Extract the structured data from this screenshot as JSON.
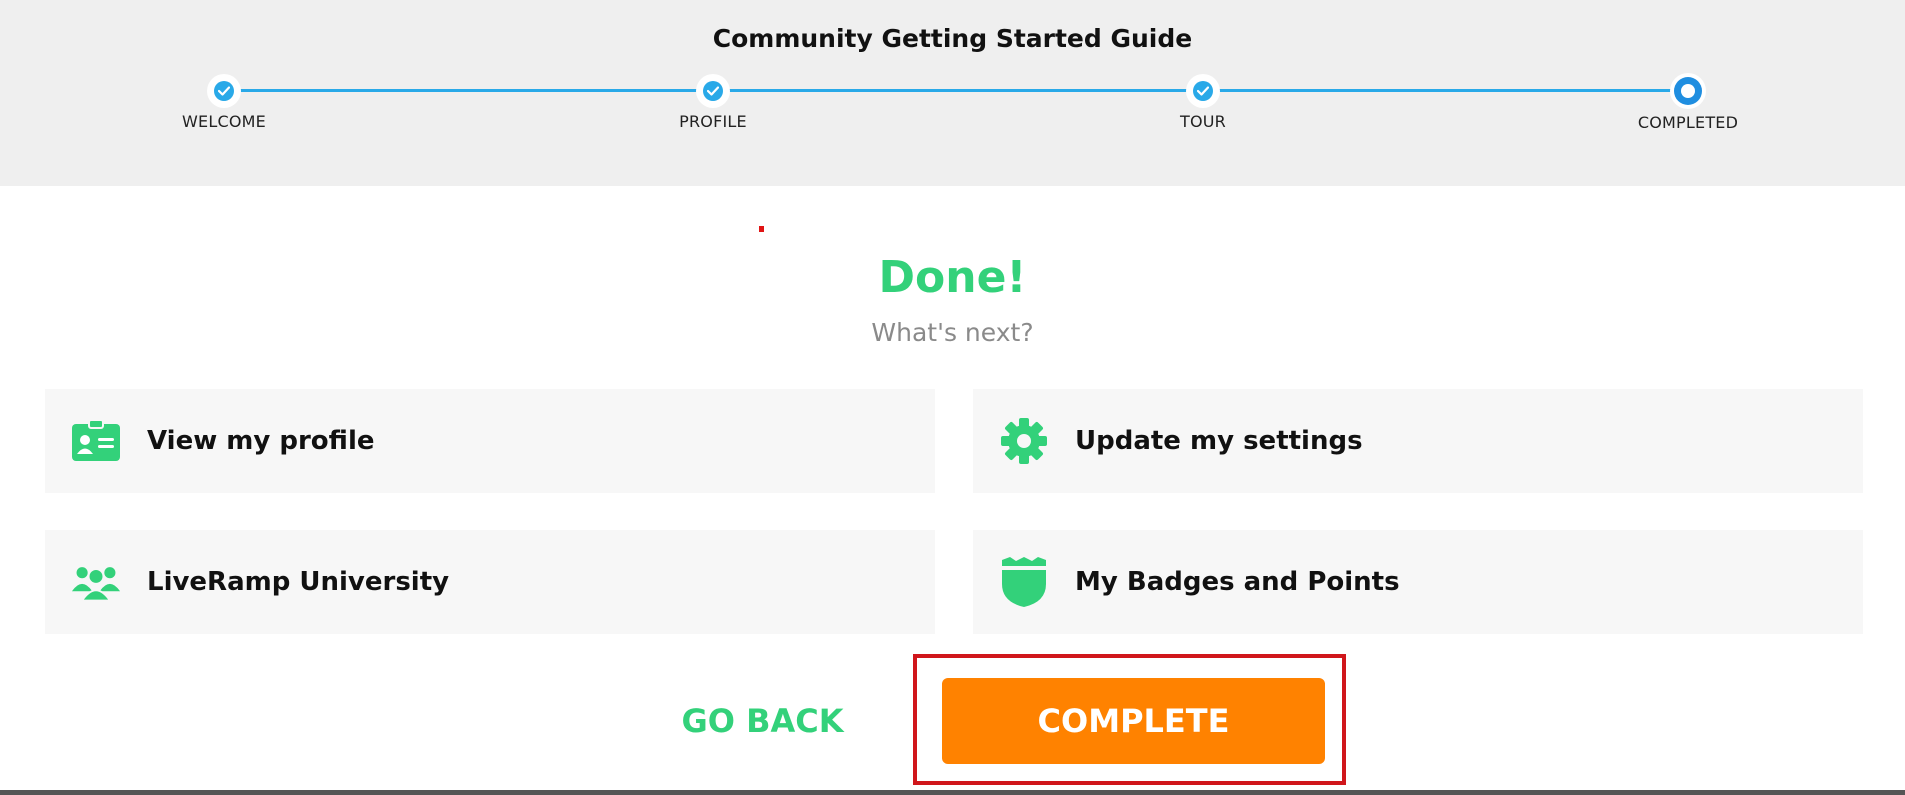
{
  "header": {
    "title": "Community Getting Started Guide",
    "steps": [
      {
        "label": "WELCOME",
        "status": "done"
      },
      {
        "label": "PROFILE",
        "status": "done"
      },
      {
        "label": "TOUR",
        "status": "done"
      },
      {
        "label": "COMPLETED",
        "status": "current"
      }
    ]
  },
  "main": {
    "title": "Done!",
    "subtitle": "What's next?",
    "cards": [
      {
        "label": "View my profile",
        "icon": "id-card-icon"
      },
      {
        "label": "Update my settings",
        "icon": "gear-icon"
      },
      {
        "label": "LiveRamp University",
        "icon": "users-group-icon"
      },
      {
        "label": "My Badges and Points",
        "icon": "badge-shield-icon"
      }
    ]
  },
  "actions": {
    "go_back_label": "GO BACK",
    "complete_label": "COMPLETE"
  },
  "colors": {
    "accent_green": "#33d17a",
    "progress_blue": "#29a9e8",
    "complete_orange": "#ff8200",
    "highlight_red": "#d0161b"
  }
}
